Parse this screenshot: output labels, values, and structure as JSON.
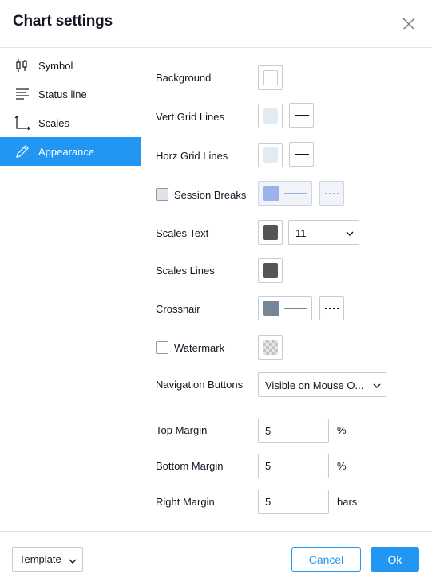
{
  "dialog": {
    "title": "Chart settings",
    "close_icon": "close-icon"
  },
  "sidebar": {
    "items": [
      {
        "label": "Symbol",
        "icon": "candlestick-icon",
        "active": false
      },
      {
        "label": "Status line",
        "icon": "status-line-icon",
        "active": false
      },
      {
        "label": "Scales",
        "icon": "scales-icon",
        "active": false
      },
      {
        "label": "Appearance",
        "icon": "pencil-icon",
        "active": true
      }
    ]
  },
  "appearance": {
    "background": {
      "label": "Background",
      "color": "#ffffff"
    },
    "vert_grid": {
      "label": "Vert Grid Lines",
      "color": "#e1ecf2",
      "line_style": "solid"
    },
    "horz_grid": {
      "label": "Horz Grid Lines",
      "color": "#e1ecf2",
      "line_style": "solid"
    },
    "session_breaks": {
      "label": "Session Breaks",
      "checked": false,
      "color": "#9db2e8",
      "line_style": "dashed"
    },
    "scales_text": {
      "label": "Scales Text",
      "color": "#555555",
      "font_size": "11"
    },
    "scales_lines": {
      "label": "Scales Lines",
      "color": "#555555"
    },
    "crosshair": {
      "label": "Crosshair",
      "color": "#758696",
      "line_style": "dashed"
    },
    "watermark": {
      "label": "Watermark",
      "checked": false
    },
    "navigation_buttons": {
      "label": "Navigation Buttons",
      "value": "Visible on Mouse O..."
    },
    "top_margin": {
      "label": "Top Margin",
      "value": "5",
      "unit": "%"
    },
    "bottom_margin": {
      "label": "Bottom Margin",
      "value": "5",
      "unit": "%"
    },
    "right_margin": {
      "label": "Right Margin",
      "value": "5",
      "unit": "bars"
    }
  },
  "footer": {
    "template_label": "Template",
    "cancel_label": "Cancel",
    "ok_label": "Ok"
  },
  "colors": {
    "accent": "#2196f3",
    "border": "#e0e3eb",
    "text": "#131722"
  }
}
